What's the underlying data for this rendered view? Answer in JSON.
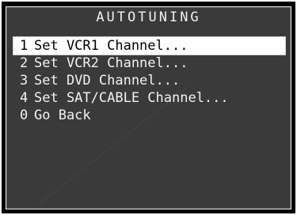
{
  "menu": {
    "title": "AUTOTUNING",
    "items": [
      {
        "num": "1",
        "label": "Set VCR1 Channel...",
        "selected": true
      },
      {
        "num": "2",
        "label": "Set VCR2 Channel...",
        "selected": false
      },
      {
        "num": "3",
        "label": "Set DVD Channel...",
        "selected": false
      },
      {
        "num": "4",
        "label": "Set SAT/CABLE Channel...",
        "selected": false
      },
      {
        "num": "0",
        "label": "Go Back",
        "selected": false
      }
    ]
  },
  "colors": {
    "background": "#3a3a3a",
    "text": "#f2f2f2",
    "highlight_bg": "#ffffff",
    "highlight_text": "#000000"
  }
}
